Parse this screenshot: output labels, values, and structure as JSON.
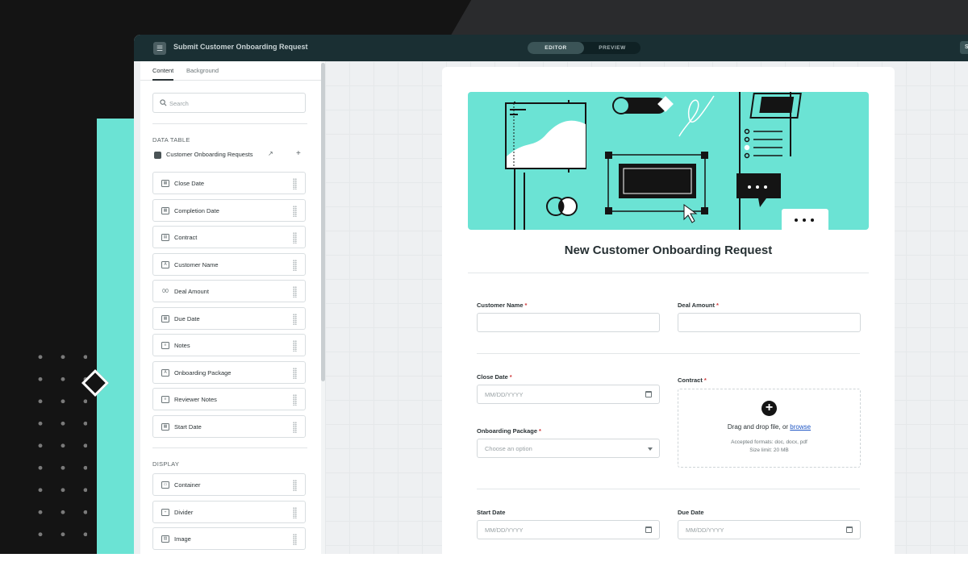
{
  "window": {
    "title": "Submit Customer Onboarding Request",
    "mode_editor": "EDITOR",
    "mode_preview": "PREVIEW",
    "right_button": "S"
  },
  "sidebar": {
    "tabs": [
      "Content",
      "Background"
    ],
    "search_placeholder": "Search",
    "data_table_heading": "DATA TABLE",
    "data_table_name": "Customer Onboarding Requests",
    "fields": [
      {
        "label": "Close Date",
        "icon": "calendar-icon"
      },
      {
        "label": "Completion Date",
        "icon": "calendar-icon"
      },
      {
        "label": "Contract",
        "icon": "file-icon"
      },
      {
        "label": "Customer Name",
        "icon": "text-field-icon"
      },
      {
        "label": "Deal Amount",
        "icon": "number-icon"
      },
      {
        "label": "Due Date",
        "icon": "calendar-icon"
      },
      {
        "label": "Notes",
        "icon": "notes-icon"
      },
      {
        "label": "Onboarding Package",
        "icon": "text-field-icon"
      },
      {
        "label": "Reviewer Notes",
        "icon": "notes-icon"
      },
      {
        "label": "Start Date",
        "icon": "calendar-icon"
      }
    ],
    "display_heading": "DISPLAY",
    "display_items": [
      {
        "label": "Container",
        "icon": "container-icon"
      },
      {
        "label": "Divider",
        "icon": "divider-icon"
      },
      {
        "label": "Image",
        "icon": "image-icon"
      }
    ]
  },
  "form": {
    "heading": "New Customer Onboarding Request",
    "customer_name_label": "Customer Name",
    "deal_amount_label": "Deal Amount",
    "close_date_label": "Close Date",
    "close_date_placeholder": "MM/DD/YYYY",
    "contract_label": "Contract",
    "onboarding_package_label": "Onboarding Package",
    "onboarding_package_placeholder": "Choose an option",
    "dropzone_text": "Drag and drop file, or",
    "dropzone_link": "browse",
    "accepted_formats": "Accepted formats: doc, docx, pdf",
    "size_limit": "Size limit: 20 MB",
    "start_date_label": "Start Date",
    "start_date_placeholder": "MM/DD/YYYY",
    "due_date_label": "Due Date",
    "due_date_placeholder": "MM/DD/YYYY",
    "required_mark": "*"
  },
  "colors": {
    "teal": "#6be3d4",
    "titlebar": "#1a2f33",
    "backdrop": "#141414",
    "link": "#1d55c4",
    "required": "#d0383a"
  }
}
